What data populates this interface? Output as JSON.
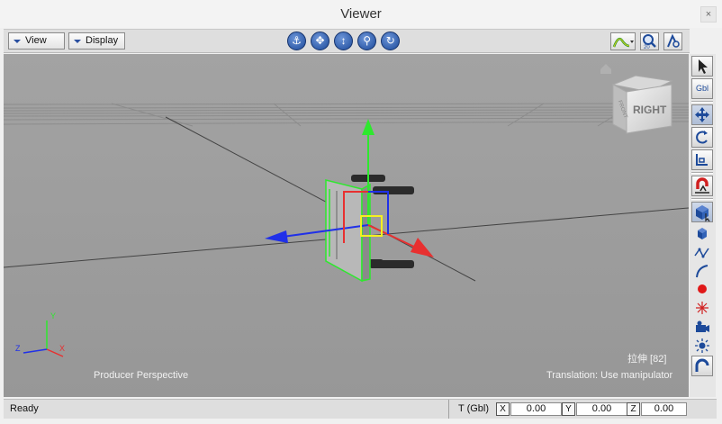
{
  "window": {
    "title": "Viewer",
    "close_glyph": "×"
  },
  "toolbar": {
    "view_menu": "View",
    "display_menu": "Display",
    "nav_icons": [
      "anchor-icon",
      "pan-icon",
      "dolly-icon",
      "zoom-icon",
      "orbit-icon"
    ],
    "right_icons": [
      "curve-icon",
      "zoom-fit-icon",
      "camera-settings-icon"
    ],
    "zoom_icon_text": "20"
  },
  "viewport": {
    "camera_label": "Producer Perspective",
    "selection_label": "拉伸 [82]",
    "hint_label": "Translation: Use manipulator",
    "viewcube_face": "RIGHT",
    "viewcube_side": "FRONT",
    "axis_labels": {
      "x": "X",
      "y": "Y",
      "z": "Z"
    },
    "colors": {
      "background": "#9c9c9c",
      "x_axis": "#e83030",
      "y_axis": "#2ee82e",
      "z_axis": "#2030e8",
      "selection": "#f5f020"
    }
  },
  "side_toolbar": {
    "gbl_label": "Gbl",
    "tools": [
      "select-icon",
      "global-mode",
      "move-icon",
      "rotate-icon",
      "scale-icon",
      "magnet-icon",
      "component-cube-icon",
      "vertex-icon",
      "curve-icon",
      "edge-icon",
      "point-icon",
      "pivot-icon",
      "camera-tool-icon",
      "light-icon",
      "hook-icon"
    ]
  },
  "statusbar": {
    "status": "Ready",
    "mode": "T (Gbl)",
    "x_label": "X",
    "x_value": "0.00",
    "y_label": "Y",
    "y_value": "0.00",
    "z_label": "Z",
    "z_value": "0.00"
  }
}
